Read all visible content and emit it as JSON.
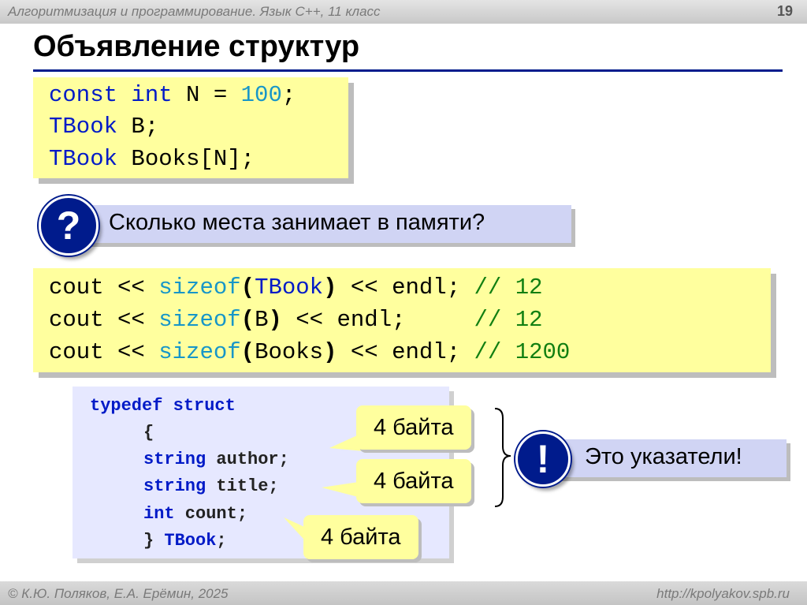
{
  "header": {
    "course": "Алгоритмизация и программирование. Язык С++, 11 класс",
    "page_number": "19"
  },
  "slide_title": "Объявление структур",
  "code1": {
    "l1": {
      "a": "const",
      "b": " ",
      "c": "int",
      "d": " N = ",
      "e": "100",
      "f": ";"
    },
    "l2": {
      "a": "TBook",
      "b": " B;"
    },
    "l3": {
      "a": "TBook",
      "b": " Books[N];"
    }
  },
  "question": {
    "icon_text": "?",
    "text": "Сколько места занимает в памяти?"
  },
  "code2": {
    "rows": [
      {
        "cout": "cout << ",
        "sizeof": "sizeof",
        "open": "(",
        "arg": "TBook",
        "close": ")",
        "rest": " << endl; ",
        "comment": "// 12"
      },
      {
        "cout": "cout << ",
        "sizeof": "sizeof",
        "open": "(",
        "arg": "B",
        "close": ")",
        "rest": " << endl;     ",
        "comment": "// 12"
      },
      {
        "cout": "cout << ",
        "sizeof": "sizeof",
        "open": "(",
        "arg": "Books",
        "close": ")",
        "rest": " << endl; ",
        "comment": "// 1200"
      }
    ]
  },
  "struct_code": {
    "l1": {
      "a": "typedef struct"
    },
    "l2": {
      "a": "{"
    },
    "l3": {
      "a": "string",
      "b": " author;"
    },
    "l4": {
      "a": "string",
      "b": " title;"
    },
    "l5": {
      "a": "int",
      "b": " count;"
    },
    "l6": {
      "a": "} ",
      "b": "TBook",
      "c": ";"
    }
  },
  "bubbles": {
    "b1": "4 байта",
    "b2": "4 байта",
    "b3": "4 байта"
  },
  "note": {
    "icon_text": "!",
    "text": "Это указатели!"
  },
  "footer": {
    "left": "© К.Ю. Поляков, Е.А. Ерёмин, 2025",
    "right": "http://kpolyakov.spb.ru"
  },
  "colors": {
    "accent": "#001b8c",
    "code_bg": "#ffff9e",
    "keyword": "#001ac7",
    "number": "#1796c8",
    "comment": "#117f11"
  }
}
